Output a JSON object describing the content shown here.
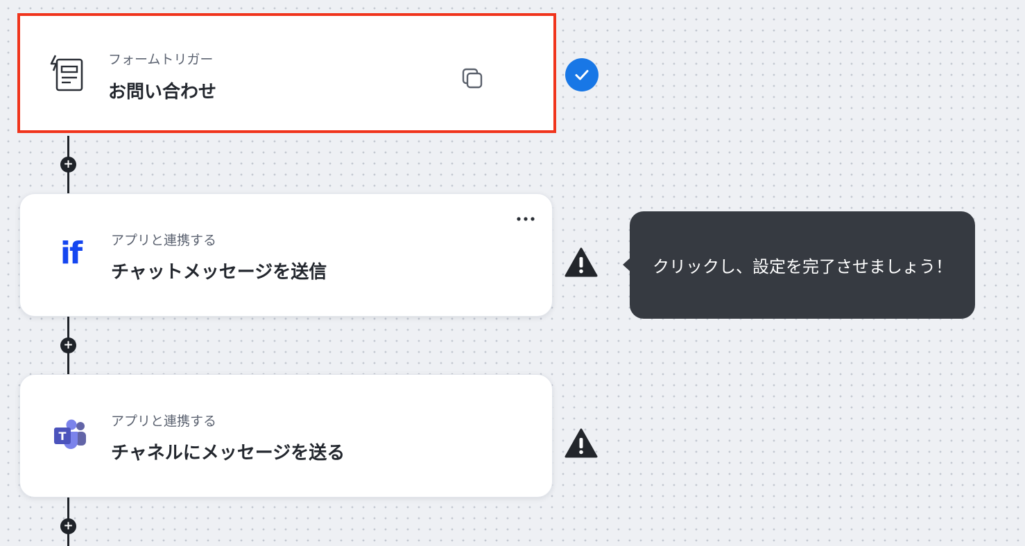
{
  "flow": {
    "steps": [
      {
        "subtitle": "フォームトリガー",
        "title": "お問い合わせ",
        "icon": "form-lightning-icon",
        "status": "check-circle-icon",
        "selected": true
      },
      {
        "subtitle": "アプリと連携する",
        "title": "チャットメッセージを送信",
        "icon": "if-app-logo-icon",
        "status": "warning-icon",
        "logo_text": "if",
        "logo_color": "#1546f0"
      },
      {
        "subtitle": "アプリと連携する",
        "title": "チャネルにメッセージを送る",
        "icon": "microsoft-teams-icon",
        "status": "warning-icon",
        "logo_text": "T",
        "logo_color": "#5b5fc7"
      }
    ],
    "add_step_symbol": "+",
    "tooltip": {
      "text": "クリックし、設定を完了させましょう！"
    }
  },
  "colors": {
    "selected_border": "#f0341c",
    "check": "#1877e6",
    "tooltip_bg": "#363a41",
    "connector": "#1f2329"
  }
}
